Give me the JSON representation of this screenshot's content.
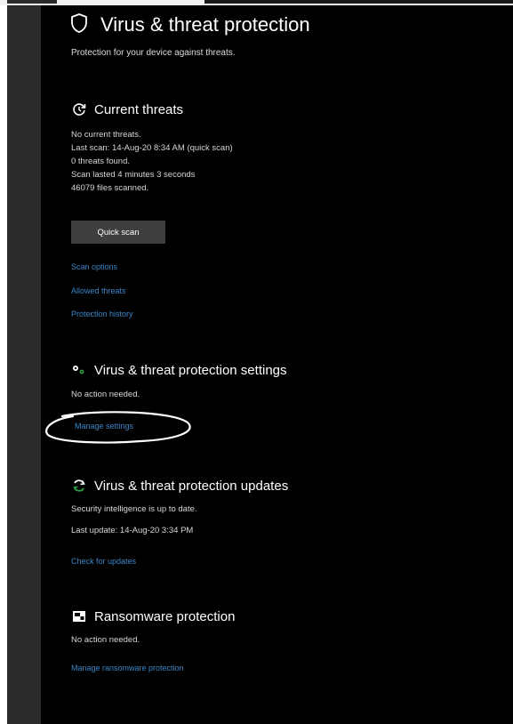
{
  "page": {
    "title": "Virus & threat protection",
    "subtitle": "Protection for your device against threats.",
    "icon": "shield-icon"
  },
  "current_threats": {
    "icon": "refresh-shield-icon",
    "title": "Current threats",
    "lines": [
      "No current threats.",
      "Last scan: 14-Aug-20 8:34 AM (quick scan)",
      "0 threats found.",
      "Scan lasted 4 minutes 3 seconds",
      "46079 files scanned."
    ],
    "quick_scan_label": "Quick scan",
    "links": [
      "Scan options",
      "Allowed threats",
      "Protection history"
    ]
  },
  "settings": {
    "icon": "settings-gears-icon",
    "title": "Virus & threat protection settings",
    "status": "No action needed.",
    "link": "Manage settings",
    "annotation_color": "#ffffff"
  },
  "updates": {
    "icon": "sync-icon",
    "title": "Virus & threat protection updates",
    "lines": [
      "Security intelligence is up to date.",
      "Last update: 14-Aug-20 3:34 PM"
    ],
    "link": "Check for updates"
  },
  "ransomware": {
    "icon": "ransomware-folder-icon",
    "title": "Ransomware protection",
    "status": "No action needed.",
    "link": "Manage ransomware protection"
  },
  "colors": {
    "background": "#000000",
    "link": "#3a86c8",
    "button": "#3f3f3f",
    "rail": "#2b2b2b",
    "accent_green": "#2ea043"
  }
}
